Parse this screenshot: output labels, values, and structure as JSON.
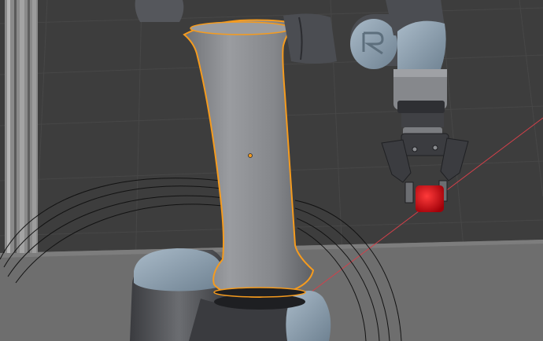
{
  "viewport": {
    "kind": "3d-viewport",
    "background_color": "#3d3d3d",
    "grid_line_color": "#474747",
    "floor_color": "#6e6e6e",
    "x_axis_color": "#d2404a",
    "selection_outline_color": "#f59b1e",
    "origin_dot_color": "#f59b1e"
  },
  "scene": {
    "robot_arm": {
      "body_color": "#8b8d91",
      "joint_cap_color": "#8fa2b3",
      "dark_ring_color": "#1e1f22",
      "upper_link_color": "#4b4d52",
      "selected_object": "robot-forearm-link"
    },
    "gripper": {
      "color": "#3b3c40"
    },
    "cube": {
      "color": "#d8101a"
    },
    "cables": {
      "color": "#121212"
    }
  }
}
